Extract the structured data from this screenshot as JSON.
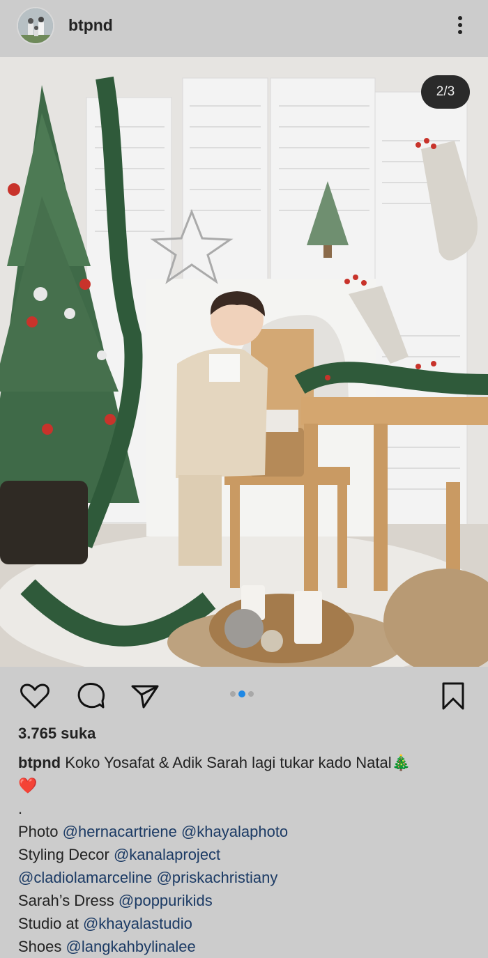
{
  "post": {
    "username": "btpnd",
    "image_counter": "2/3",
    "carousel": {
      "total": 3,
      "active": 2
    },
    "likes_text": "3.765 suka",
    "caption": {
      "username": "btpnd",
      "text": "Koko Yosafat & Adik Sarah lagi tukar kado Natal",
      "emoji_tree": "🎄",
      "emoji_heart": "❤️",
      "separator": "."
    },
    "credits": [
      {
        "label": "Photo",
        "mentions": [
          "@hernacartriene",
          "@khayalaphoto"
        ]
      },
      {
        "label": "Styling Decor",
        "mentions": [
          "@kanalaproject"
        ]
      },
      {
        "label": "",
        "mentions": [
          "@cladiolamarceline",
          "@priskachristiany"
        ]
      },
      {
        "label": "Sarah’s Dress",
        "mentions": [
          "@poppurikids"
        ]
      },
      {
        "label": "Studio at",
        "mentions": [
          "@khayalastudio"
        ]
      },
      {
        "label": "Shoes",
        "mentions": [
          "@langkahbylinalee"
        ]
      }
    ]
  },
  "icons": {
    "like": "heart-icon",
    "comment": "comment-bubble-icon",
    "share": "paper-plane-icon",
    "save": "bookmark-icon",
    "more": "vertical-dots-icon"
  },
  "colors": {
    "background": "#cccccc",
    "mention": "#1b3a64",
    "active_dot": "#1e88e5",
    "counter_bg": "#2a2a2a"
  }
}
